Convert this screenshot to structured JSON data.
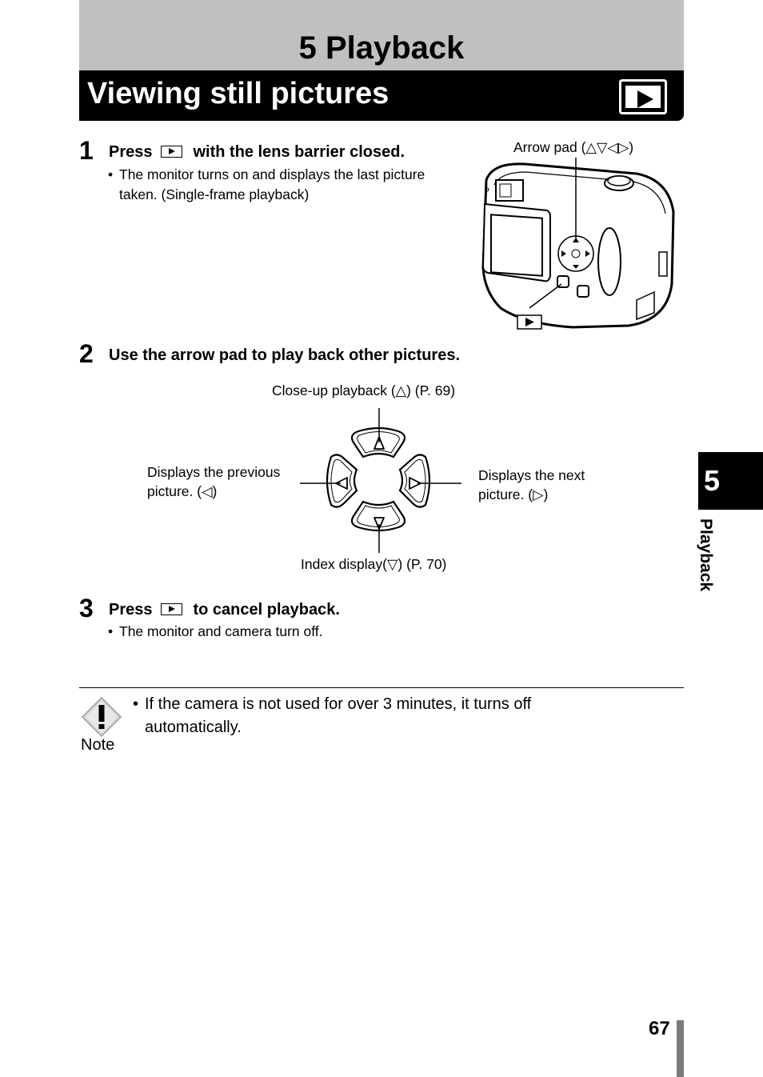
{
  "header": {
    "chapter_title": "5 Playback",
    "section_title": "Viewing still pictures",
    "section_icon": "playback-icon"
  },
  "steps": [
    {
      "number": "1",
      "text_before_icon": "Press",
      "icon": "playback-button-icon",
      "text_after_icon": "with the lens barrier closed.",
      "bullets": [
        "The monitor turns on and displays the last picture",
        "taken. (Single-frame playback)"
      ]
    },
    {
      "number": "2",
      "text": "Use the arrow pad to play back other pictures."
    },
    {
      "number": "3",
      "text_before_icon": "Press",
      "icon": "playback-button-icon",
      "text_after_icon": "to cancel playback.",
      "bullets": [
        "The monitor and camera turn off."
      ]
    }
  ],
  "camera_figure": {
    "arrow_pad_label": "Arrow pad (△▽◁▷)",
    "playback_button_callout": "playback-button-icon"
  },
  "arrow_pad_figure": {
    "up_label": "Close-up playback (△) (P. 69)",
    "left_label_line1": "Displays the previous",
    "left_label_line2": "picture. (◁)",
    "right_label_line1": "Displays the next",
    "right_label_line2": "picture. (▷)",
    "down_label": "Index display(▽) (P. 70)"
  },
  "note": {
    "icon_label": "Note",
    "bullet": "•",
    "text_line1": "If the camera is not used for over 3 minutes, it turns off",
    "text_line2": "automatically."
  },
  "side_tab": {
    "chapter_number": "5",
    "chapter_label": "Playback"
  },
  "footer": {
    "page_number": "67"
  }
}
